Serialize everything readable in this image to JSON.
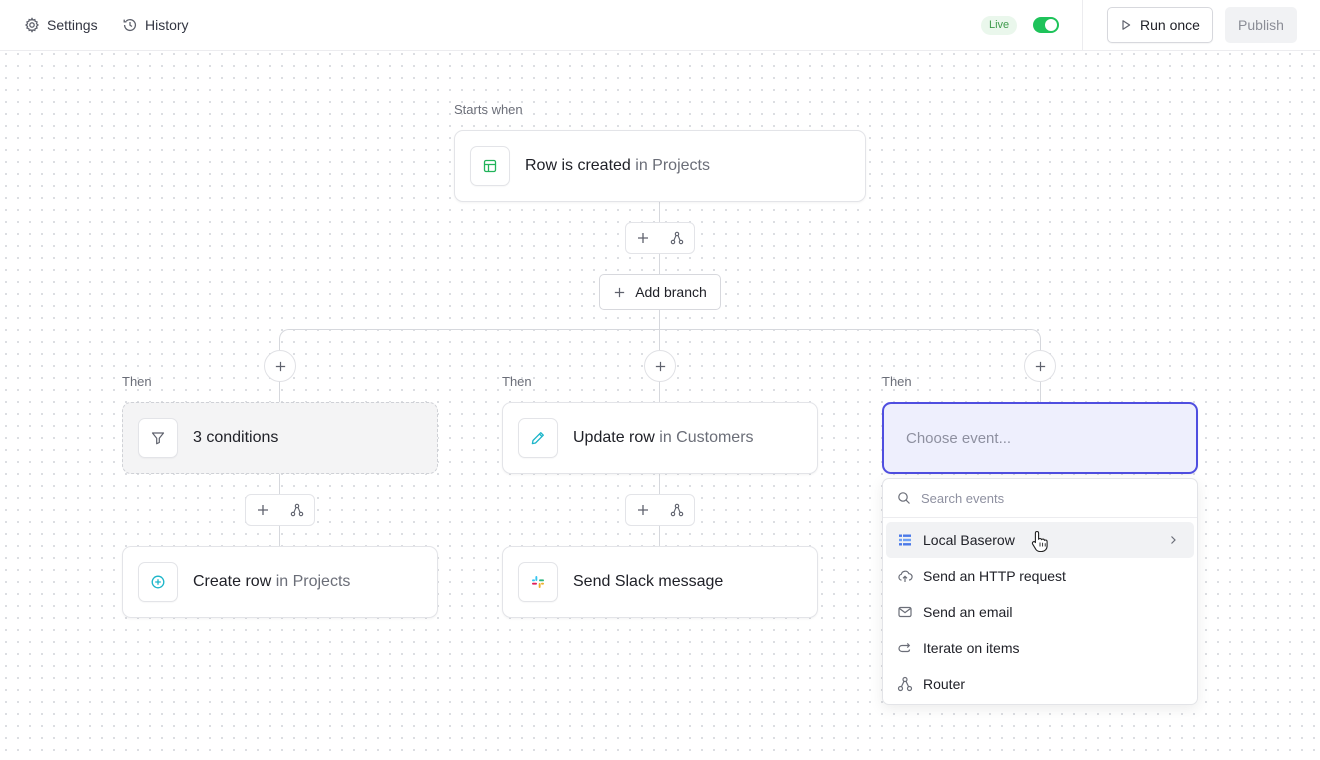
{
  "header": {
    "settings_label": "Settings",
    "history_label": "History",
    "live_badge": "Live",
    "live_toggle_on": true,
    "run_once_label": "Run once",
    "publish_label": "Publish"
  },
  "colors": {
    "accent": "#4f4ee0",
    "live_green": "#1ec35a",
    "trigger_icon": "#22b35a",
    "create_icon": "#1cb5c9"
  },
  "trigger": {
    "section_label": "Starts when",
    "title": "Row is created",
    "context": "in Projects",
    "icon": "table-icon"
  },
  "add_branch_label": "Add branch",
  "branches": [
    {
      "label": "Then",
      "nodes": [
        {
          "title": "3 conditions",
          "context": "",
          "icon": "filter-icon",
          "style": "dashed"
        },
        {
          "title": "Create row",
          "context": "in Projects",
          "icon": "plus-circle-icon"
        }
      ]
    },
    {
      "label": "Then",
      "nodes": [
        {
          "title": "Update row",
          "context": "in Customers",
          "icon": "pencil-icon"
        },
        {
          "title": "Send Slack message",
          "context": "",
          "icon": "slack-icon"
        }
      ]
    },
    {
      "label": "Then",
      "nodes": [
        {
          "placeholder": "Choose event...",
          "style": "selected"
        }
      ]
    }
  ],
  "event_menu": {
    "search_placeholder": "Search events",
    "items": [
      {
        "label": "Local Baserow",
        "icon": "baserow-icon",
        "has_submenu": true,
        "hovered": true
      },
      {
        "label": "Send an HTTP request",
        "icon": "cloud-upload-icon"
      },
      {
        "label": "Send an email",
        "icon": "mail-icon"
      },
      {
        "label": "Iterate on items",
        "icon": "loop-icon"
      },
      {
        "label": "Router",
        "icon": "router-icon"
      }
    ]
  }
}
